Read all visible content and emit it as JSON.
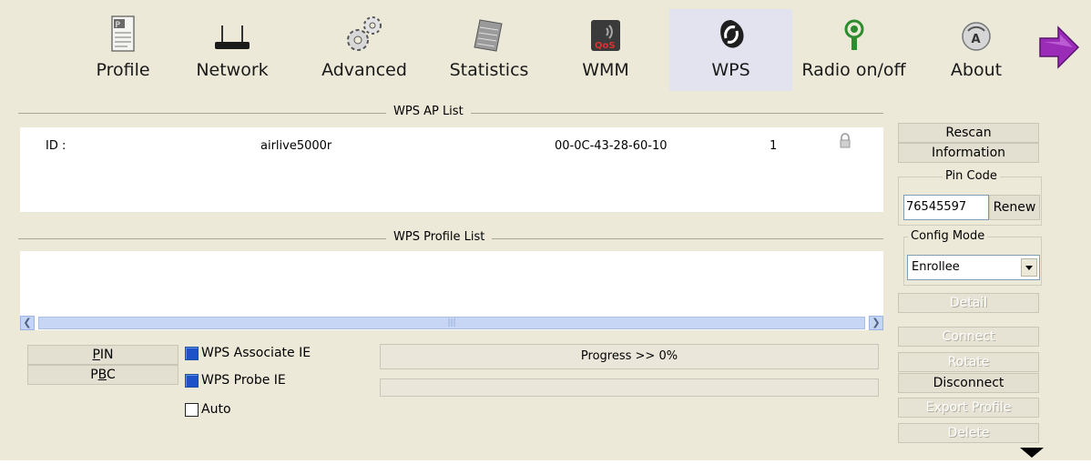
{
  "toolbar": {
    "items": [
      {
        "label": "Profile",
        "icon": "profile-icon"
      },
      {
        "label": "Network",
        "icon": "network-icon"
      },
      {
        "label": "Advanced",
        "icon": "advanced-icon"
      },
      {
        "label": "Statistics",
        "icon": "statistics-icon"
      },
      {
        "label": "WMM",
        "icon": "wmm-icon",
        "badge": "QoS"
      },
      {
        "label": "WPS",
        "icon": "wps-icon",
        "active": true
      },
      {
        "label": "Radio on/off",
        "icon": "radio-icon"
      },
      {
        "label": "About",
        "icon": "about-icon",
        "badge": "A"
      }
    ]
  },
  "ap_list": {
    "title": "WPS AP List",
    "rows": [
      {
        "id": "ID :",
        "ssid": "airlive5000r",
        "bssid": "00-0C-43-28-60-10",
        "channel": "1"
      }
    ]
  },
  "profile_list": {
    "title": "WPS Profile List",
    "rows": []
  },
  "buttons": {
    "pin": "PIN",
    "pbc": "PBC"
  },
  "checkboxes": {
    "associate_ie": {
      "label": "WPS Associate IE",
      "checked": true
    },
    "probe_ie": {
      "label": "WPS Probe IE",
      "checked": true
    },
    "auto": {
      "label": "Auto",
      "checked": false
    }
  },
  "progress": {
    "text": "Progress >> 0%",
    "value": 0
  },
  "side": {
    "rescan": "Rescan",
    "information": "Information",
    "pin_code_legend": "Pin Code",
    "pin_code_value": "76545597",
    "renew": "Renew",
    "config_mode_legend": "Config Mode",
    "config_mode_value": "Enrollee",
    "detail": "Detail",
    "connect": "Connect",
    "rotate": "Rotate",
    "disconnect": "Disconnect",
    "export_profile": "Export Profile",
    "delete": "Delete"
  },
  "colors": {
    "background": "#ece9d8",
    "active_tab": "#e2e3ef",
    "checkbox_checked": "#1e52c8",
    "arrow": "#9b2cb8"
  }
}
